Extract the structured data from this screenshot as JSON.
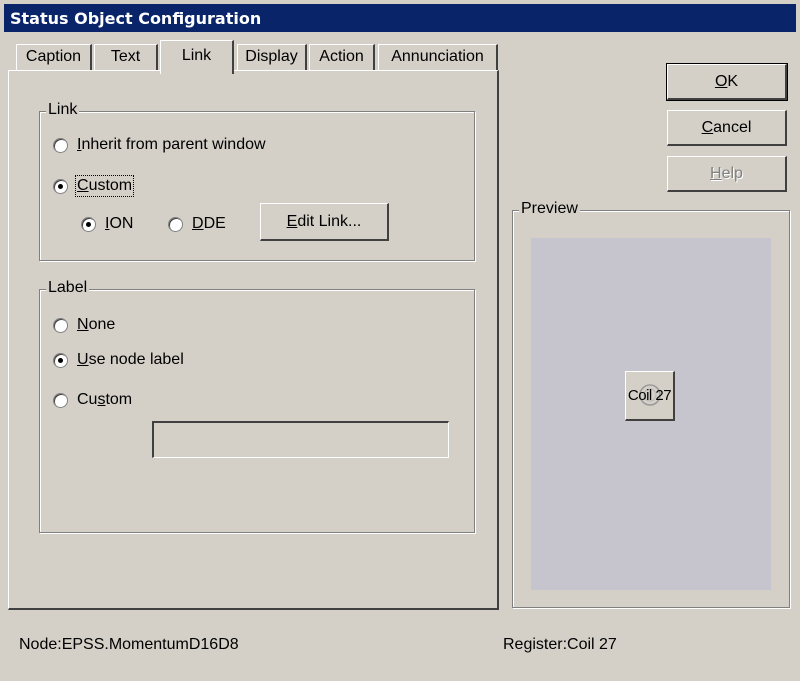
{
  "window": {
    "title": "Status Object Configuration"
  },
  "tabs": [
    {
      "label": "Caption"
    },
    {
      "label": "Text"
    },
    {
      "label": "Link"
    },
    {
      "label": "Display"
    },
    {
      "label": "Action"
    },
    {
      "label": "Annunciation"
    }
  ],
  "active_tab": "Link",
  "link_group": {
    "title": "Link",
    "inherit_label": "Inherit from parent window",
    "custom_label": "Custom",
    "ion_label": "ION",
    "dde_label": "DDE",
    "edit_link_label": "Edit Link...",
    "selected": "Custom",
    "protocol_selected": "ION"
  },
  "label_group": {
    "title": "Label",
    "none_label": "None",
    "use_node_label": "Use node label",
    "custom_label": "Custom",
    "custom_value": "",
    "selected": "Use node label"
  },
  "buttons": {
    "ok": "OK",
    "cancel": "Cancel",
    "help": "Help"
  },
  "preview": {
    "title": "Preview",
    "object_label": "Coil 27",
    "bg_color": "#c6c5ce"
  },
  "statusbar": {
    "node": "Node:EPSS.MomentumD16D8",
    "register": "Register:Coil 27"
  }
}
